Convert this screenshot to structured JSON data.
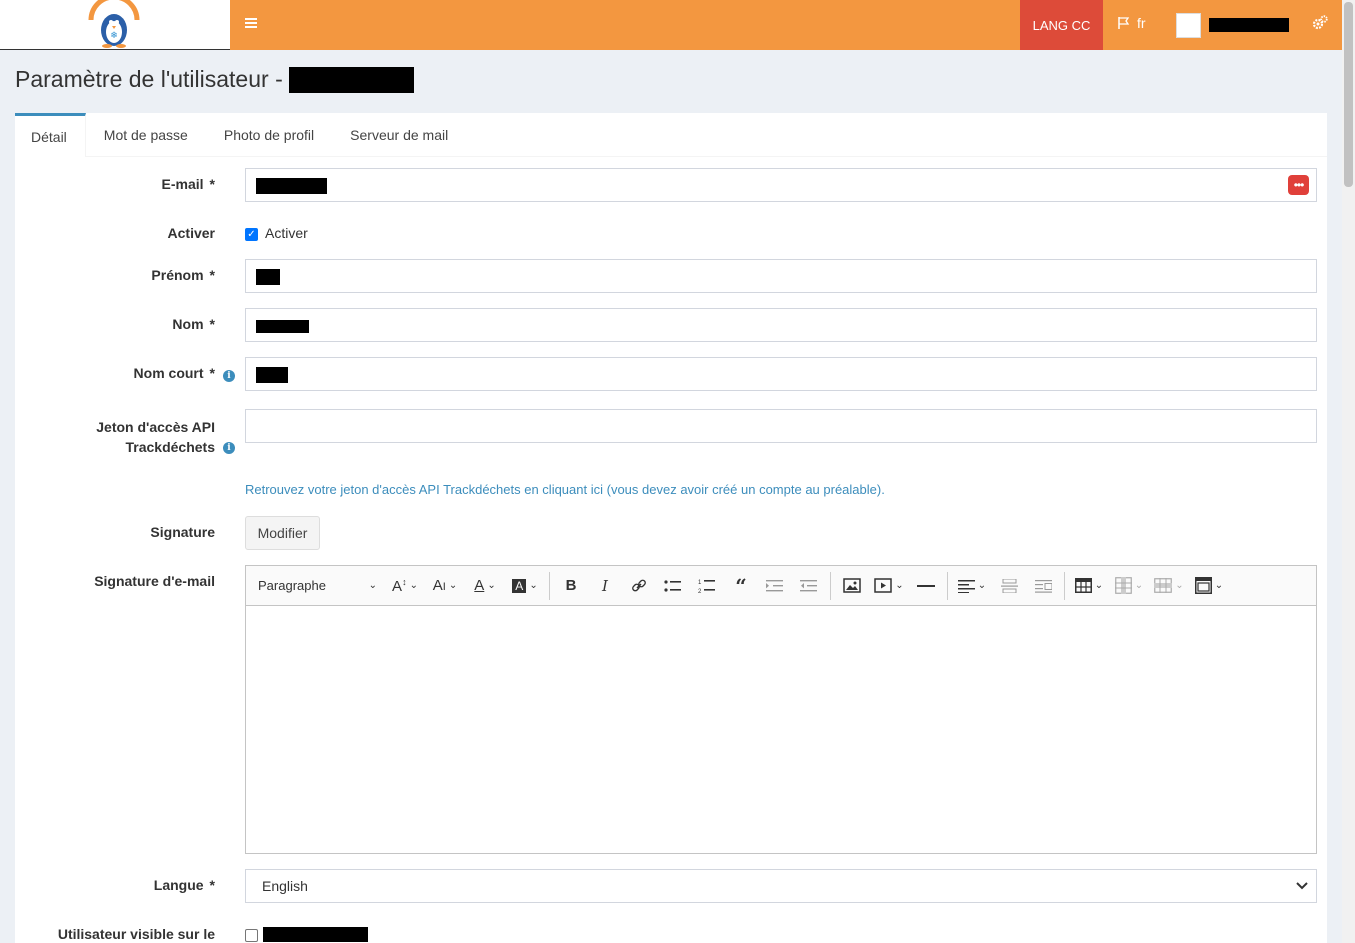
{
  "brand": {
    "logo_alt": "CLIM FRAIS"
  },
  "header": {
    "menu_icon": "bars-icon",
    "lang_cc_label": "LANG CC",
    "language_label": "fr",
    "settings_icon": "gears-icon"
  },
  "page": {
    "title": "Paramètre de l'utilisateur -"
  },
  "tabs": [
    {
      "label": "Détail",
      "active": true
    },
    {
      "label": "Mot de passe"
    },
    {
      "label": "Photo de profil"
    },
    {
      "label": "Serveur de mail"
    }
  ],
  "form": {
    "email_label": "E-mail",
    "activate_label": "Activer",
    "activate_checkbox_label": "Activer",
    "firstname_label": "Prénom",
    "lastname_label": "Nom",
    "shortname_label": "Nom court",
    "api_token_label_1": "Jeton d'accès API",
    "api_token_label_2": "Trackdéchets",
    "api_help_link": "Retrouvez votre jeton d'accès API Trackdéchets en cliquant ici (vous devez avoir créé un compte au préalable).",
    "signature_label": "Signature",
    "signature_button": "Modifier",
    "email_signature_label": "Signature d'e-mail",
    "editor_paragraph": "Paragraphe",
    "language_label": "Langue",
    "language_value": "English",
    "visible_user_label": "Utilisateur visible sur le",
    "required_mark": "*",
    "info_mark": "i"
  },
  "colors": {
    "header": "#f39740",
    "lang_cc": "#dd4b39",
    "accent": "#3c8dbc"
  }
}
